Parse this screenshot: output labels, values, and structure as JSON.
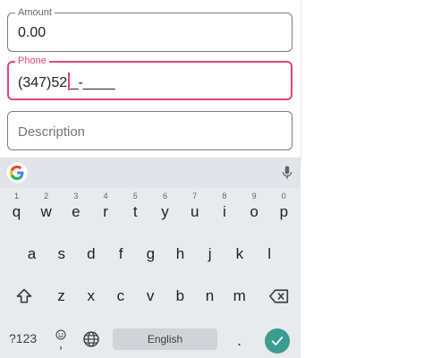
{
  "form": {
    "amount": {
      "legend": "Amount",
      "value": "0.00"
    },
    "phone": {
      "legend": "Phone",
      "value_before_cursor": "(347)52",
      "value_after_cursor": "_-____"
    },
    "description": {
      "placeholder": "Description"
    }
  },
  "keyboard": {
    "row1": [
      {
        "key": "q",
        "hint": "1"
      },
      {
        "key": "w",
        "hint": "2"
      },
      {
        "key": "e",
        "hint": "3"
      },
      {
        "key": "r",
        "hint": "4"
      },
      {
        "key": "t",
        "hint": "5"
      },
      {
        "key": "y",
        "hint": "6"
      },
      {
        "key": "u",
        "hint": "7"
      },
      {
        "key": "i",
        "hint": "8"
      },
      {
        "key": "o",
        "hint": "9"
      },
      {
        "key": "p",
        "hint": "0"
      }
    ],
    "row2": [
      "a",
      "s",
      "d",
      "f",
      "g",
      "h",
      "j",
      "k",
      "l"
    ],
    "row3": [
      "z",
      "x",
      "c",
      "v",
      "b",
      "n",
      "m"
    ],
    "numbers_label": "?123",
    "space_label": "English",
    "period_label": ".",
    "icons": {
      "google": "google-g-icon",
      "mic": "microphone-icon",
      "shift": "shift-arrow-icon",
      "backspace": "backspace-icon",
      "emoji": "emoji-icon",
      "globe": "globe-icon",
      "enter": "checkmark-icon"
    },
    "colors": {
      "accent": "#e0457b",
      "enter_button": "#3a9d8f",
      "keyboard_bg": "#e8eaed"
    }
  }
}
